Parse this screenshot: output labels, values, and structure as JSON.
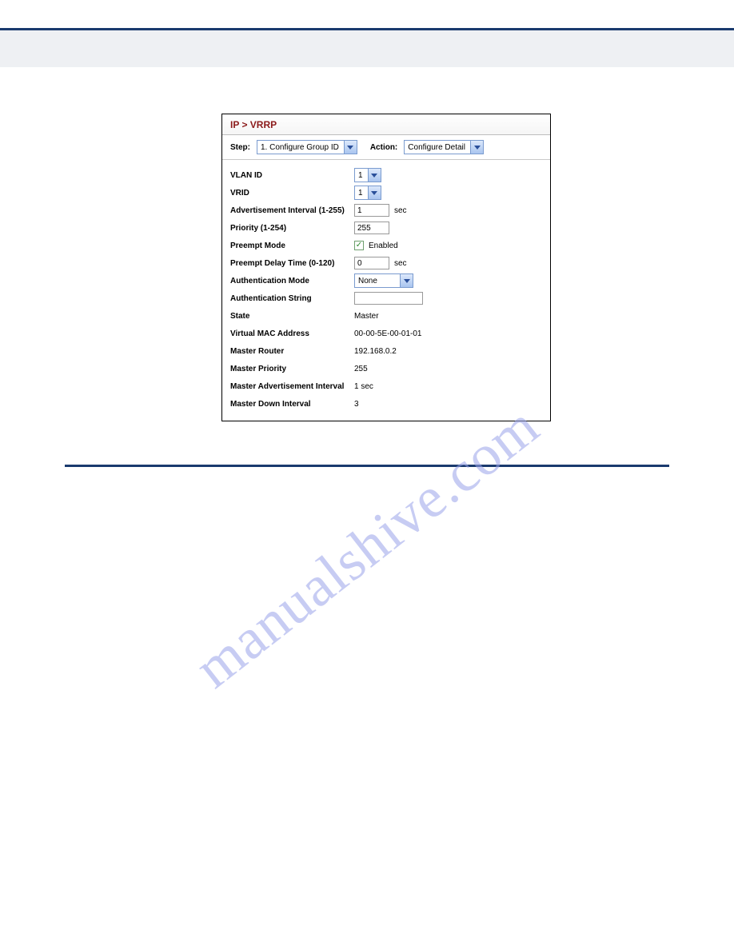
{
  "watermark": "manualshive.com",
  "panel": {
    "breadcrumb": "IP > VRRP",
    "step_label": "Step:",
    "step_value": "1. Configure Group ID",
    "action_label": "Action:",
    "action_value": "Configure Detail"
  },
  "fields": {
    "vlan_id_label": "VLAN ID",
    "vlan_id_value": "1",
    "vrid_label": "VRID",
    "vrid_value": "1",
    "adv_int_label": "Advertisement Interval (1-255)",
    "adv_int_value": "1",
    "adv_int_unit": "sec",
    "priority_label": "Priority (1-254)",
    "priority_value": "255",
    "preempt_label": "Preempt Mode",
    "preempt_enabled_text": "Enabled",
    "preempt_delay_label": "Preempt Delay Time (0-120)",
    "preempt_delay_value": "0",
    "preempt_delay_unit": "sec",
    "auth_mode_label": "Authentication Mode",
    "auth_mode_value": "None",
    "auth_string_label": "Authentication String",
    "auth_string_value": "",
    "state_label": "State",
    "state_value": "Master",
    "vmac_label": "Virtual MAC Address",
    "vmac_value": "00-00-5E-00-01-01",
    "master_router_label": "Master Router",
    "master_router_value": "192.168.0.2",
    "master_priority_label": "Master Priority",
    "master_priority_value": "255",
    "master_adv_label": "Master Advertisement Interval",
    "master_adv_value": "1 sec",
    "master_down_label": "Master Down Interval",
    "master_down_value": "3"
  }
}
